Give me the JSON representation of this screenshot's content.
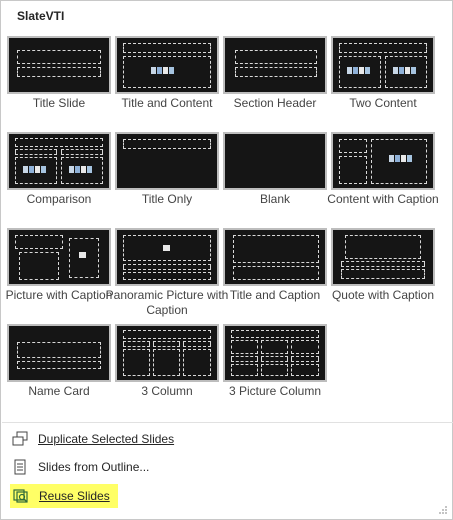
{
  "panel": {
    "title": "SlateVTI"
  },
  "layouts": [
    {
      "key": "title-slide",
      "label": "Title Slide"
    },
    {
      "key": "title-and-content",
      "label": "Title and Content"
    },
    {
      "key": "section-header",
      "label": "Section Header"
    },
    {
      "key": "two-content",
      "label": "Two Content"
    },
    {
      "key": "comparison",
      "label": "Comparison"
    },
    {
      "key": "title-only",
      "label": "Title Only"
    },
    {
      "key": "blank",
      "label": "Blank"
    },
    {
      "key": "content-with-caption",
      "label": "Content with Caption"
    },
    {
      "key": "picture-with-caption",
      "label": "Picture with Caption"
    },
    {
      "key": "panoramic-picture-with-caption",
      "label": "Panoramic Picture with Caption"
    },
    {
      "key": "title-and-caption",
      "label": "Title and Caption"
    },
    {
      "key": "quote-with-caption",
      "label": "Quote with Caption"
    },
    {
      "key": "name-card",
      "label": "Name Card"
    },
    {
      "key": "3-column",
      "label": "3 Column"
    },
    {
      "key": "3-picture-column",
      "label": "3 Picture Column"
    }
  ],
  "menu": {
    "duplicate": "Duplicate Selected Slides",
    "outline": "Slides from Outline...",
    "reuse": "Reuse Slides"
  },
  "colors": {
    "thumbnail_bg": "#151515",
    "placeholder": "#d9d9d9",
    "highlight": "#ffff66"
  }
}
